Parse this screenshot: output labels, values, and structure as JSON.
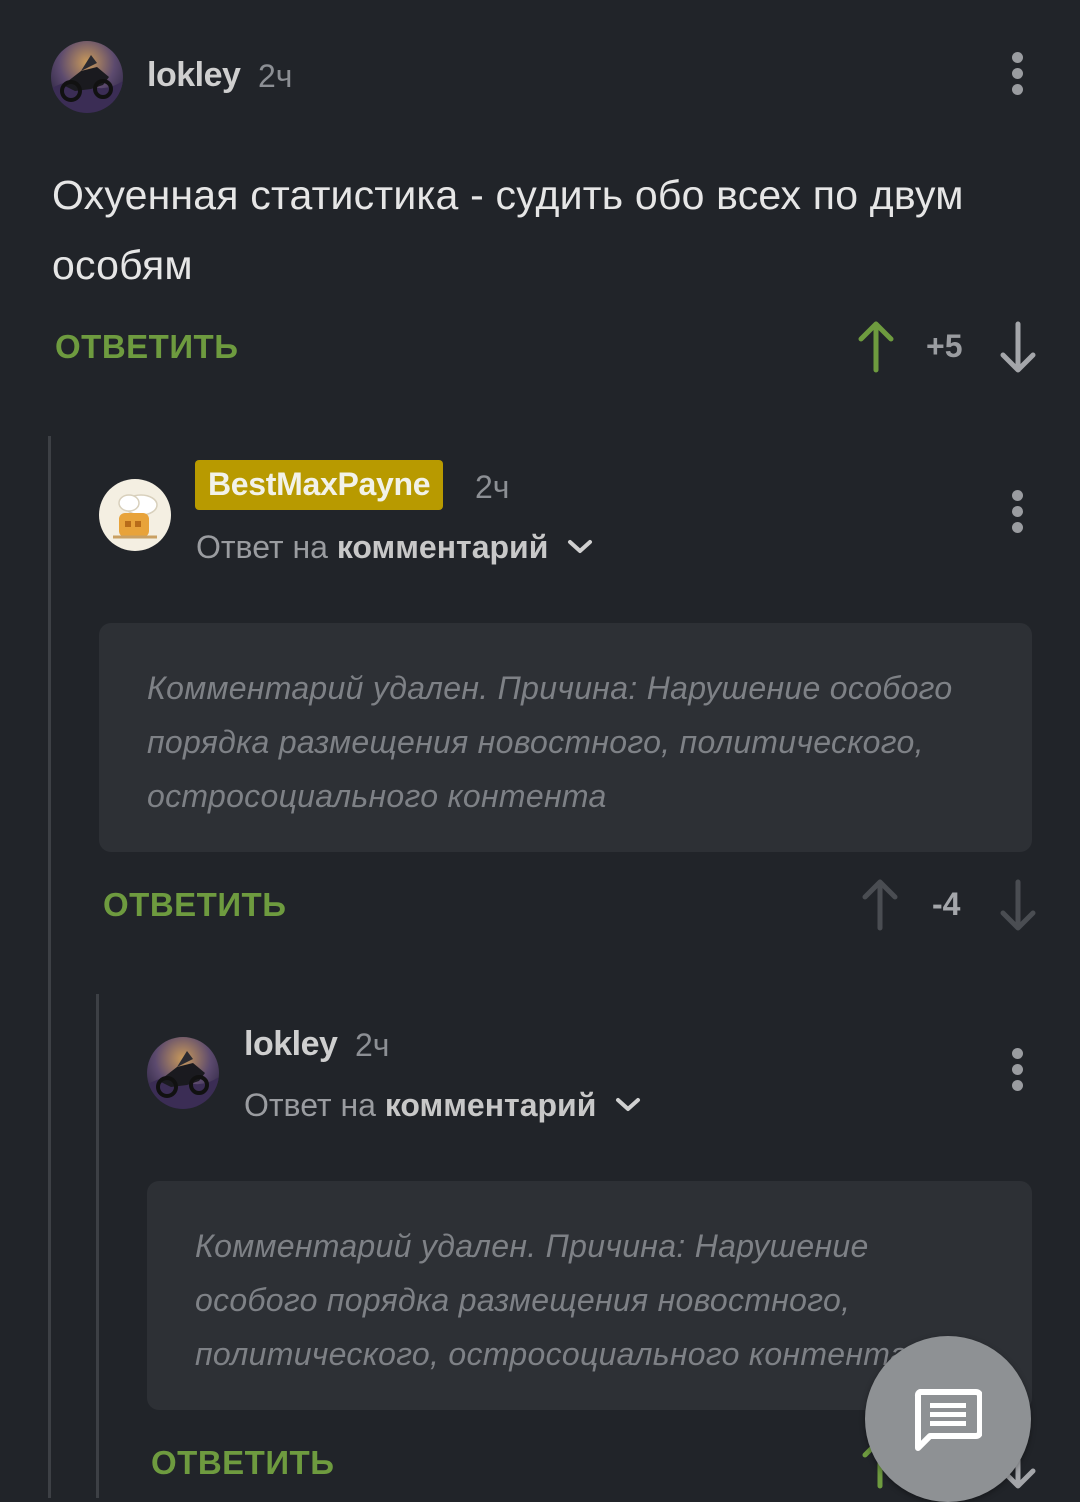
{
  "comments": [
    {
      "username": "lokley",
      "time": "2ч",
      "text": "Охуенная статистика - судить обо всех по двум особям",
      "reply_label": "ОТВЕТИТЬ",
      "score": "+5",
      "score_color": "#9a9ca0",
      "upvote_color": "#6e9b3f",
      "avatar": "motorcycle-avatar"
    },
    {
      "username": "BestMaxPayne",
      "username_badge_color": "#b89a00",
      "time": "2ч",
      "reply_to_prefix": "Ответ на",
      "reply_to_target": "комментарий",
      "deleted_text": "Комментарий удален. Причина: Нарушение особого порядка размещения новостного, политического, остросоциального контента",
      "reply_label": "ОТВЕТИТЬ",
      "score": "-4",
      "score_color": "#a4a6aa",
      "avatar": "cartoon-avatar"
    },
    {
      "username": "lokley",
      "time": "2ч",
      "reply_to_prefix": "Ответ на",
      "reply_to_target": "комментарий",
      "deleted_text": "Комментарий удален. Причина: Нарушение особого порядка размещения новостного, политического, остросоциального контента",
      "reply_label": "ОТВЕТИТЬ",
      "avatar": "motorcycle-avatar"
    }
  ],
  "fab": {
    "icon": "comment-icon"
  },
  "colors": {
    "background": "#212429",
    "accent_green": "#6e9b3f",
    "deleted_box": "#2d3035"
  }
}
